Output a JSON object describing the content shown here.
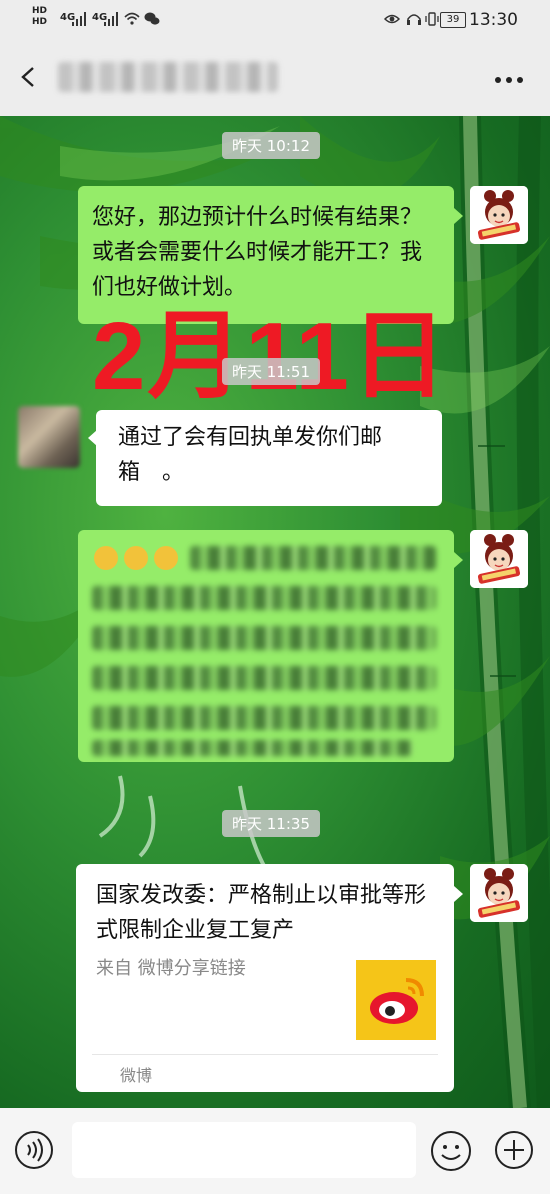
{
  "status_bar": {
    "hd1": "HD",
    "hd2": "HD",
    "net1": "4G",
    "net2": "4G",
    "battery": "39",
    "time": "13:30"
  },
  "header": {
    "chat_title": "██ · ███"
  },
  "messages": [
    {
      "time": "昨天 10:12"
    },
    {
      "text": "您好，那边预计什么时候有结果？或者会需要什么时候才能开工？我们也好做计划。"
    },
    {
      "time": "昨天 11:51"
    },
    {
      "text": "通过了会有回执单发你们邮箱　。"
    },
    {
      "time": "昨天 11:35"
    }
  ],
  "overlay": {
    "big_date": "2月11日"
  },
  "link_card": {
    "title": "国家发改委：严格制止以审批等形式限制企业复工复产",
    "source": "来自 微博分享链接",
    "footer": "微博"
  },
  "colors": {
    "bubble_green": "#95ec69",
    "date_red": "#ee1a24",
    "bar_gray": "#ededed"
  }
}
